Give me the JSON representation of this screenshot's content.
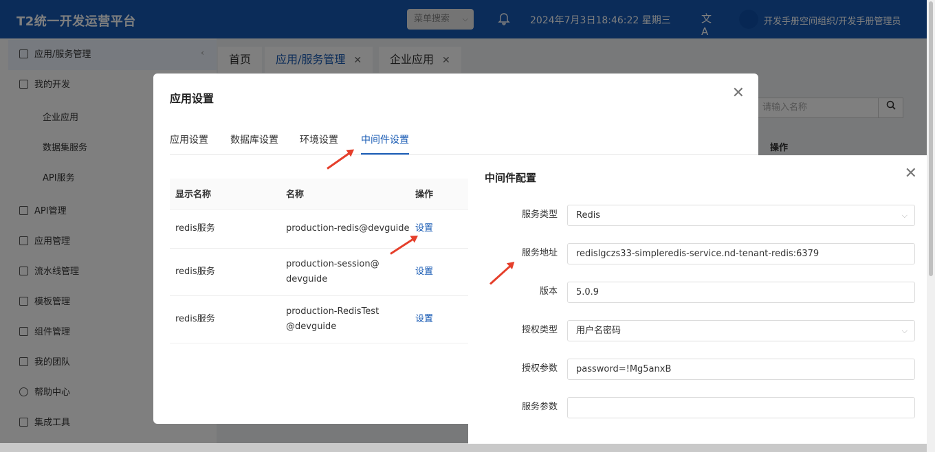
{
  "header": {
    "title": "T2统一开发运营平台",
    "menu_search": "菜单搜索",
    "datetime": "2024年7月3日18:46:22 星期三",
    "user": "开发手册空间组织/开发手册管理员"
  },
  "sidebar": {
    "items": [
      {
        "label": "应用/服务管理",
        "icon": "grid-icon"
      },
      {
        "label": "我的开发",
        "icon": "code-icon"
      },
      {
        "label": "企业应用"
      },
      {
        "label": "数据集服务"
      },
      {
        "label": "API服务"
      },
      {
        "label": "API管理",
        "icon": "link-icon"
      },
      {
        "label": "应用管理",
        "icon": "apps-icon"
      },
      {
        "label": "流水线管理",
        "icon": "pipeline-icon"
      },
      {
        "label": "模板管理",
        "icon": "template-icon"
      },
      {
        "label": "组件管理",
        "icon": "component-icon"
      },
      {
        "label": "我的团队",
        "icon": "team-icon"
      },
      {
        "label": "帮助中心",
        "icon": "help-icon"
      },
      {
        "label": "集成工具",
        "icon": "folder-icon"
      }
    ]
  },
  "page_tabs": [
    {
      "label": "首页"
    },
    {
      "label": "应用/服务管理"
    },
    {
      "label": "企业应用"
    }
  ],
  "background": {
    "search_placeholder": "请输入名称",
    "op_header": "操作"
  },
  "app_modal": {
    "title": "应用设置",
    "tabs": [
      "应用设置",
      "数据库设置",
      "环境设置",
      "中间件设置"
    ],
    "active_tab": "中间件设置",
    "columns": [
      "显示名称",
      "名称",
      "操作"
    ],
    "rows": [
      {
        "display": "redis服务",
        "name": "production-redis@devguide",
        "action": "设置"
      },
      {
        "display": "redis服务",
        "name": "production-session@devguide",
        "action": "设置"
      },
      {
        "display": "redis服务",
        "name": "production-RedisTest@devguide",
        "action": "设置"
      }
    ]
  },
  "mw_modal": {
    "title": "中间件配置",
    "fields": {
      "service_type": {
        "label": "服务类型",
        "value": "Redis"
      },
      "service_addr": {
        "label": "服务地址",
        "value": "redislgczs33-simpleredis-service.nd-tenant-redis:6379"
      },
      "version": {
        "label": "版本",
        "value": "5.0.9"
      },
      "auth_type": {
        "label": "授权类型",
        "value": "用户名密码"
      },
      "auth_params": {
        "label": "授权参数",
        "value": "password=!Mg5anxB"
      },
      "service_params": {
        "label": "服务参数",
        "value": ""
      }
    }
  },
  "colors": {
    "primary": "#1659b3",
    "annotation_arrow": "#e53f2b"
  }
}
